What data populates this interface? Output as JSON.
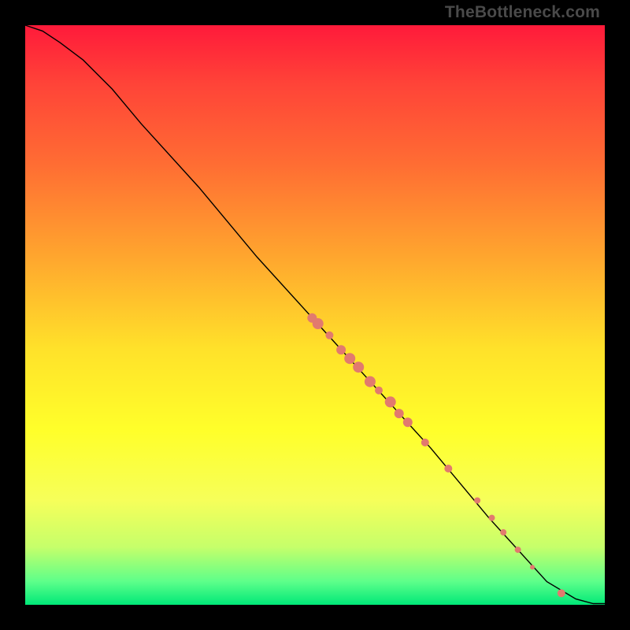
{
  "watermark": "TheBottleneck.com",
  "colors": {
    "background": "#000000",
    "marker": "#e27a6e",
    "line": "#000000"
  },
  "chart_data": {
    "type": "line",
    "title": "",
    "xlabel": "",
    "ylabel": "",
    "xlim": [
      0,
      100
    ],
    "ylim": [
      0,
      100
    ],
    "grid": false,
    "legend": false,
    "series": [
      {
        "name": "curve",
        "kind": "line",
        "x": [
          0,
          3,
          6,
          10,
          15,
          20,
          30,
          40,
          50,
          60,
          70,
          80,
          90,
          95,
          98,
          100
        ],
        "y": [
          100,
          99,
          97,
          94,
          89,
          83,
          72,
          60,
          49,
          38,
          27,
          15,
          4,
          1,
          0.2,
          0.2
        ]
      },
      {
        "name": "markers-cluster",
        "kind": "scatter",
        "points": [
          {
            "x": 49.5,
            "y": 49.5,
            "r": 6
          },
          {
            "x": 50.5,
            "y": 48.5,
            "r": 7
          },
          {
            "x": 52.5,
            "y": 46.5,
            "r": 5
          },
          {
            "x": 54.5,
            "y": 44.0,
            "r": 6
          },
          {
            "x": 56.0,
            "y": 42.5,
            "r": 7
          },
          {
            "x": 57.5,
            "y": 41.0,
            "r": 7
          },
          {
            "x": 59.5,
            "y": 38.5,
            "r": 7
          },
          {
            "x": 61.0,
            "y": 37.0,
            "r": 5
          },
          {
            "x": 63.0,
            "y": 35.0,
            "r": 7
          },
          {
            "x": 64.5,
            "y": 33.0,
            "r": 6
          },
          {
            "x": 66.0,
            "y": 31.5,
            "r": 6
          },
          {
            "x": 69.0,
            "y": 28.0,
            "r": 5
          },
          {
            "x": 73.0,
            "y": 23.5,
            "r": 5
          },
          {
            "x": 78.0,
            "y": 18.0,
            "r": 4
          },
          {
            "x": 80.5,
            "y": 15.0,
            "r": 4
          },
          {
            "x": 82.5,
            "y": 12.5,
            "r": 4
          },
          {
            "x": 85.0,
            "y": 9.5,
            "r": 4
          },
          {
            "x": 87.5,
            "y": 6.5,
            "r": 3
          },
          {
            "x": 92.5,
            "y": 2.0,
            "r": 5
          }
        ]
      }
    ]
  }
}
